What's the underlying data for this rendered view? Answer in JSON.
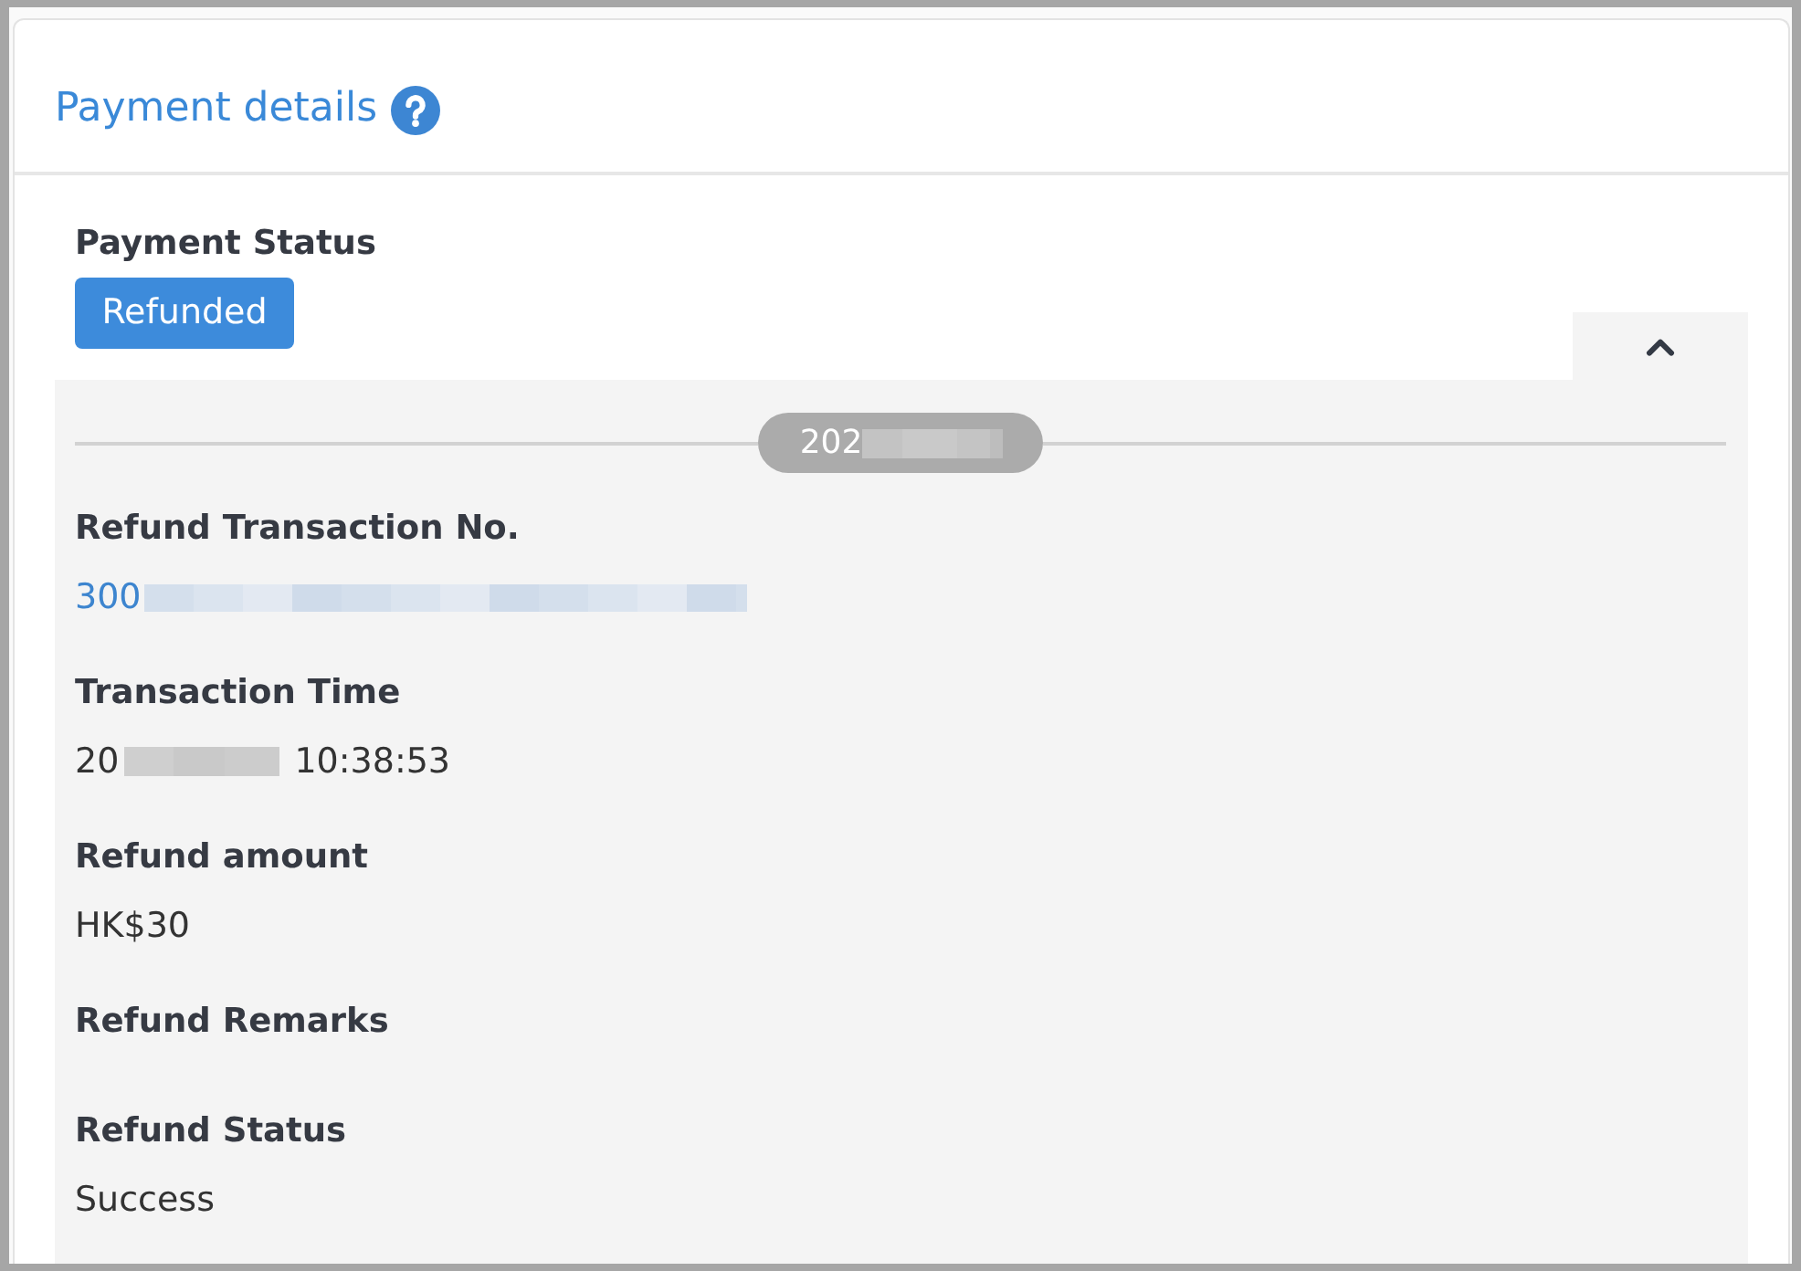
{
  "card": {
    "title": "Payment details"
  },
  "payment_status": {
    "label": "Payment Status",
    "badge": "Refunded"
  },
  "collapse_toggle": {
    "expanded": true
  },
  "refund": {
    "date": [
      {
        "kind": "text",
        "text": "202"
      },
      {
        "kind": "redacted"
      }
    ],
    "fields": [
      {
        "label": "Refund Transaction No.",
        "kind": "link",
        "value": [
          {
            "kind": "text",
            "text": "300"
          },
          {
            "kind": "redacted"
          }
        ]
      },
      {
        "label": "Transaction Time",
        "kind": "text",
        "value": [
          {
            "kind": "text",
            "text": "20"
          },
          {
            "kind": "redacted"
          },
          {
            "kind": "text",
            "text": "10:38:53"
          }
        ]
      },
      {
        "label": "Refund amount",
        "kind": "text",
        "value": [
          {
            "kind": "text",
            "text": "HK$30"
          }
        ]
      },
      {
        "label": "Refund Remarks"
      },
      {
        "label": "Refund Status",
        "kind": "text",
        "value": [
          {
            "kind": "text",
            "text": "Success"
          }
        ]
      }
    ]
  }
}
